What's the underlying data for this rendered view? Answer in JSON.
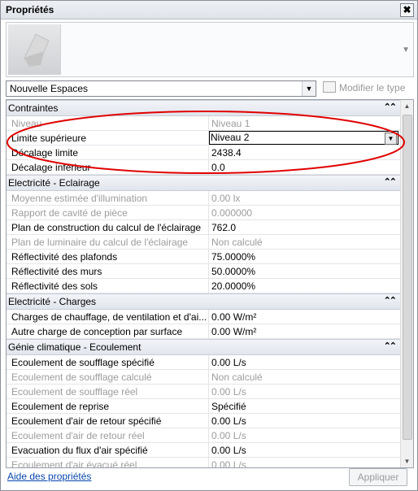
{
  "window": {
    "title": "Propriétés",
    "close_glyph": "✖",
    "accent": "#e00000"
  },
  "type_selector": {
    "value": "Nouvelle Espaces",
    "edit_type_label": "Modifier le type"
  },
  "categories": [
    {
      "label": "Contraintes",
      "rows": [
        {
          "name": "Niveau",
          "value": "Niveau 1",
          "disabled": true
        },
        {
          "name": "Limite supérieure",
          "value": "Niveau 2",
          "disabled": false,
          "active": true
        },
        {
          "name": "Décalage limite",
          "value": "2438.4",
          "disabled": false
        },
        {
          "name": "Décalage inférieur",
          "value": "0.0",
          "disabled": false
        }
      ]
    },
    {
      "label": "Electricité - Eclairage",
      "rows": [
        {
          "name": "Moyenne estimée d'illumination",
          "value": "0.00 lx",
          "disabled": true
        },
        {
          "name": "Rapport de cavité de pièce",
          "value": "0.000000",
          "disabled": true
        },
        {
          "name": "Plan de construction du calcul de l'éclairage",
          "value": "762.0",
          "disabled": false
        },
        {
          "name": "Plan de luminaire du calcul de l'éclairage",
          "value": "Non calculé",
          "disabled": true
        },
        {
          "name": "Réflectivité des plafonds",
          "value": "75.0000%",
          "disabled": false
        },
        {
          "name": "Réflectivité des murs",
          "value": "50.0000%",
          "disabled": false
        },
        {
          "name": "Réflectivité des sols",
          "value": "20.0000%",
          "disabled": false
        }
      ]
    },
    {
      "label": "Electricité - Charges",
      "rows": [
        {
          "name": "Charges de chauffage, de ventilation et d'ai...",
          "value": "0.00 W/m²",
          "disabled": false
        },
        {
          "name": "Autre charge de conception par surface",
          "value": "0.00 W/m²",
          "disabled": false
        }
      ]
    },
    {
      "label": "Génie climatique - Ecoulement",
      "rows": [
        {
          "name": "Ecoulement de soufflage spécifié",
          "value": "0.00 L/s",
          "disabled": false
        },
        {
          "name": "Ecoulement de soufflage calculé",
          "value": "Non calculé",
          "disabled": true
        },
        {
          "name": "Ecoulement de soufflage réel",
          "value": "0.00 L/s",
          "disabled": true
        },
        {
          "name": "Ecoulement de reprise",
          "value": "Spécifié",
          "disabled": false
        },
        {
          "name": "Ecoulement d'air de retour spécifié",
          "value": "0.00 L/s",
          "disabled": false
        },
        {
          "name": "Ecoulement d'air de retour réel",
          "value": "0.00 L/s",
          "disabled": true
        },
        {
          "name": "Evacuation du flux d'air spécifié",
          "value": "0.00 L/s",
          "disabled": false
        },
        {
          "name": "Ecoulement d'air évacué réel",
          "value": "0.00 L/s",
          "disabled": true
        }
      ]
    }
  ],
  "footer": {
    "help_link": "Aide des propriétés",
    "apply_label": "Appliquer"
  }
}
